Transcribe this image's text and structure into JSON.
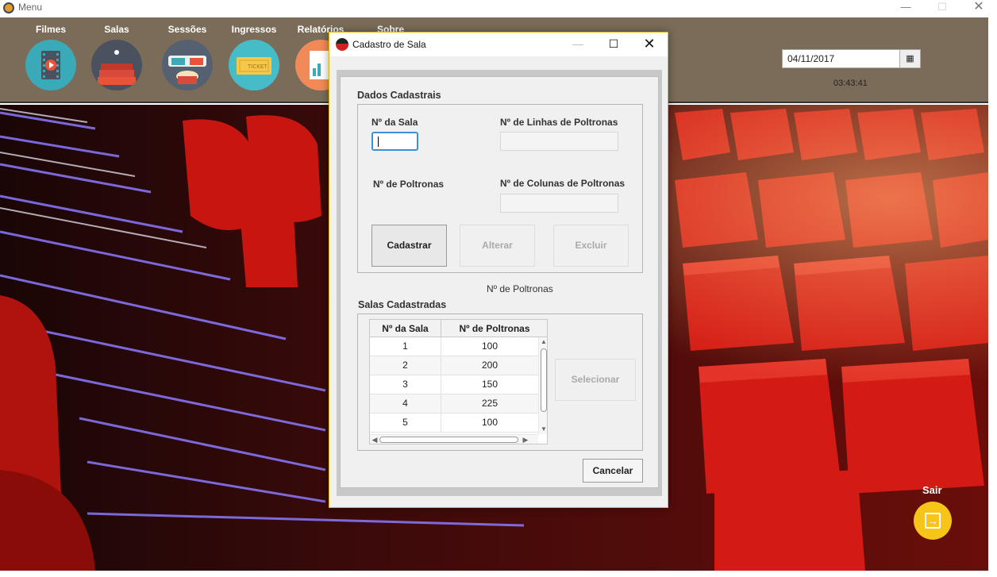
{
  "window": {
    "title": "Menu",
    "minimize": "—",
    "maximize": "☐",
    "close": "✕"
  },
  "nav": {
    "items": [
      {
        "label": "Filmes",
        "icon": "film-reel-icon"
      },
      {
        "label": "Salas",
        "icon": "cinema-seats-icon"
      },
      {
        "label": "Sessões",
        "icon": "3d-glasses-popcorn-icon"
      },
      {
        "label": "Ingressos",
        "icon": "ticket-icon"
      },
      {
        "label": "Relatórios",
        "icon": "report-icon"
      },
      {
        "label": "Sobre",
        "icon": "info-icon"
      }
    ]
  },
  "header": {
    "date": "04/11/2017",
    "calendar_icon": "▦",
    "time": "03:43:41"
  },
  "sair": {
    "label": "Sair",
    "icon": "exit-icon",
    "glyph": "→"
  },
  "dialog": {
    "title": "Cadastro de Sala",
    "minimize": "—",
    "maximize": "☐",
    "close": "✕",
    "dados_title": "Dados Cadastrais",
    "fields": {
      "num_sala_label": "Nº da Sala",
      "num_sala_value": "",
      "linhas_label": "Nº de Linhas de Poltronas",
      "linhas_value": "",
      "num_poltronas_label": "Nº de Poltronas",
      "colunas_label": "Nº de Colunas de Poltronas",
      "colunas_value": ""
    },
    "buttons": {
      "cadastrar": "Cadastrar",
      "alterar": "Alterar",
      "excluir": "Excluir",
      "selecionar": "Selecionar",
      "cancelar": "Cancelar"
    },
    "poltronas_caption": "Nº de Poltronas",
    "salas_title": "Salas Cadastradas",
    "table": {
      "columns": [
        "Nº da Sala",
        "Nº de Poltronas"
      ],
      "rows": [
        [
          "1",
          "100"
        ],
        [
          "2",
          "200"
        ],
        [
          "3",
          "150"
        ],
        [
          "4",
          "225"
        ],
        [
          "5",
          "100"
        ]
      ]
    }
  },
  "colors": {
    "header_bg": "#7a6c58",
    "accent_yellow": "#f7c51a",
    "focus_blue": "#3c8fd8",
    "seat_red": "#d41a14"
  }
}
